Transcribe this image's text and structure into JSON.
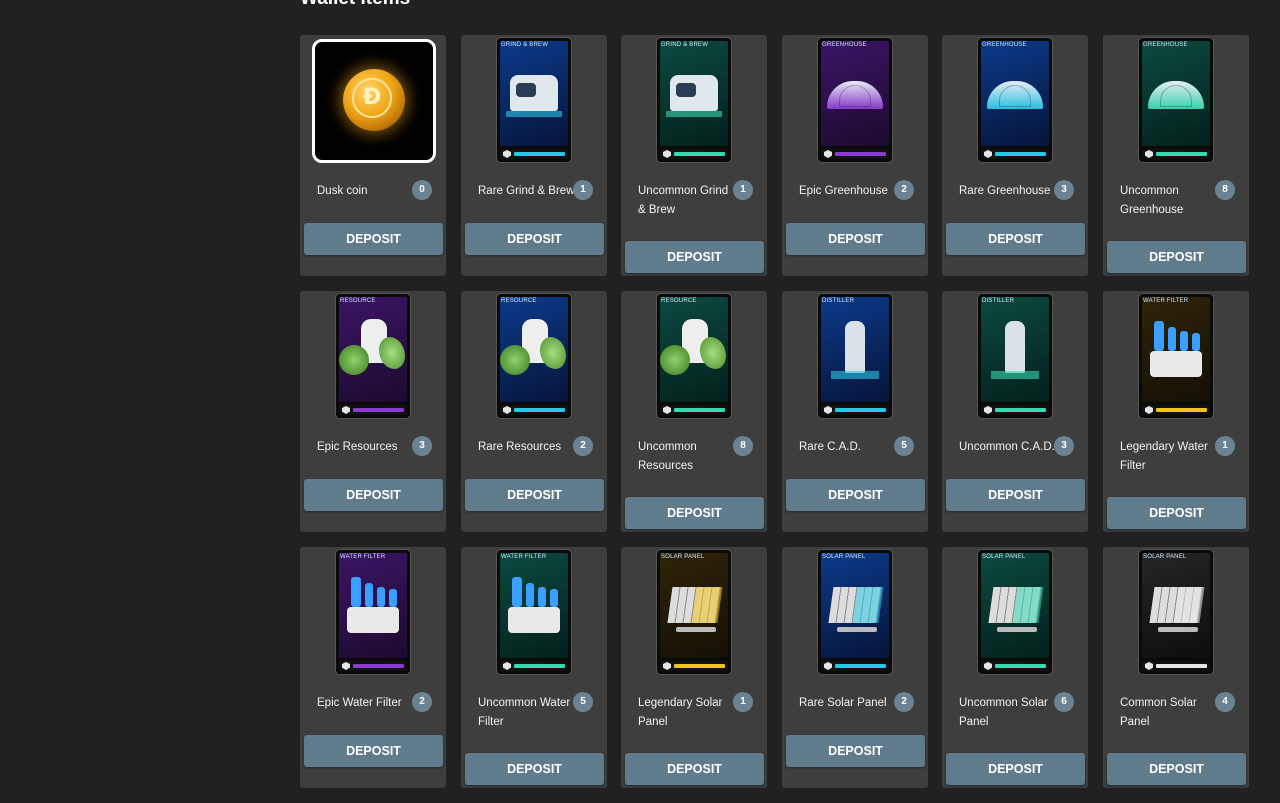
{
  "header": {
    "title": "Wallet Items"
  },
  "colors": {
    "epic": "#8a3ad0",
    "rare": "#2bc7e6",
    "uncommon": "#39d9b0",
    "legendary": "#f2c21b",
    "common": "#e8e8e8",
    "button": "#5f7b8c"
  },
  "items": [
    {
      "name": "Dusk coin",
      "count": "0",
      "deposit": "DEPOSIT",
      "category": "",
      "rarity": "coin",
      "icon": "dusk-coin-icon"
    },
    {
      "name": "Rare Grind & Brew",
      "count": "1",
      "deposit": "DEPOSIT",
      "category": "GRIND & BREW",
      "rarity": "rare",
      "icon": "grind-brew-card-icon"
    },
    {
      "name": "Uncommon Grind & Brew",
      "count": "1",
      "deposit": "DEPOSIT",
      "category": "GRIND & BREW",
      "rarity": "uncommon",
      "icon": "grind-brew-card-icon"
    },
    {
      "name": "Epic Greenhouse",
      "count": "2",
      "deposit": "DEPOSIT",
      "category": "GREENHOUSE",
      "rarity": "epic",
      "icon": "greenhouse-card-icon"
    },
    {
      "name": "Rare Greenhouse",
      "count": "3",
      "deposit": "DEPOSIT",
      "category": "GREENHOUSE",
      "rarity": "rare",
      "icon": "greenhouse-card-icon"
    },
    {
      "name": "Uncommon Greenhouse",
      "count": "8",
      "deposit": "DEPOSIT",
      "category": "GREENHOUSE",
      "rarity": "uncommon",
      "icon": "greenhouse-card-icon"
    },
    {
      "name": "Epic Resources",
      "count": "3",
      "deposit": "DEPOSIT",
      "category": "RESOURCE",
      "rarity": "epic",
      "icon": "resource-card-icon"
    },
    {
      "name": "Rare Resources",
      "count": "2",
      "deposit": "DEPOSIT",
      "category": "RESOURCE",
      "rarity": "rare",
      "icon": "resource-card-icon"
    },
    {
      "name": "Uncommon Resources",
      "count": "8",
      "deposit": "DEPOSIT",
      "category": "RESOURCE",
      "rarity": "uncommon",
      "icon": "resource-card-icon"
    },
    {
      "name": "Rare C.A.D.",
      "count": "5",
      "deposit": "DEPOSIT",
      "category": "DISTILLER",
      "rarity": "rare",
      "icon": "distiller-card-icon"
    },
    {
      "name": "Uncommon C.A.D.",
      "count": "3",
      "deposit": "DEPOSIT",
      "category": "DISTILLER",
      "rarity": "uncommon",
      "icon": "distiller-card-icon"
    },
    {
      "name": "Legendary Water Filter",
      "count": "1",
      "deposit": "DEPOSIT",
      "category": "WATER FILTER",
      "rarity": "legendary",
      "icon": "water-filter-card-icon"
    },
    {
      "name": "Epic Water Filter",
      "count": "2",
      "deposit": "DEPOSIT",
      "category": "WATER FILTER",
      "rarity": "epic",
      "icon": "water-filter-card-icon"
    },
    {
      "name": "Uncommon Water Filter",
      "count": "5",
      "deposit": "DEPOSIT",
      "category": "WATER FILTER",
      "rarity": "uncommon",
      "icon": "water-filter-card-icon"
    },
    {
      "name": "Legendary Solar Panel",
      "count": "1",
      "deposit": "DEPOSIT",
      "category": "SOLAR PANEL",
      "rarity": "legendary",
      "icon": "solar-panel-card-icon"
    },
    {
      "name": "Rare Solar Panel",
      "count": "2",
      "deposit": "DEPOSIT",
      "category": "SOLAR PANEL",
      "rarity": "rare",
      "icon": "solar-panel-card-icon"
    },
    {
      "name": "Uncommon Solar Panel",
      "count": "6",
      "deposit": "DEPOSIT",
      "category": "SOLAR PANEL",
      "rarity": "uncommon",
      "icon": "solar-panel-card-icon"
    },
    {
      "name": "Common Solar Panel",
      "count": "4",
      "deposit": "DEPOSIT",
      "category": "SOLAR PANEL",
      "rarity": "common",
      "icon": "solar-panel-card-icon"
    }
  ]
}
